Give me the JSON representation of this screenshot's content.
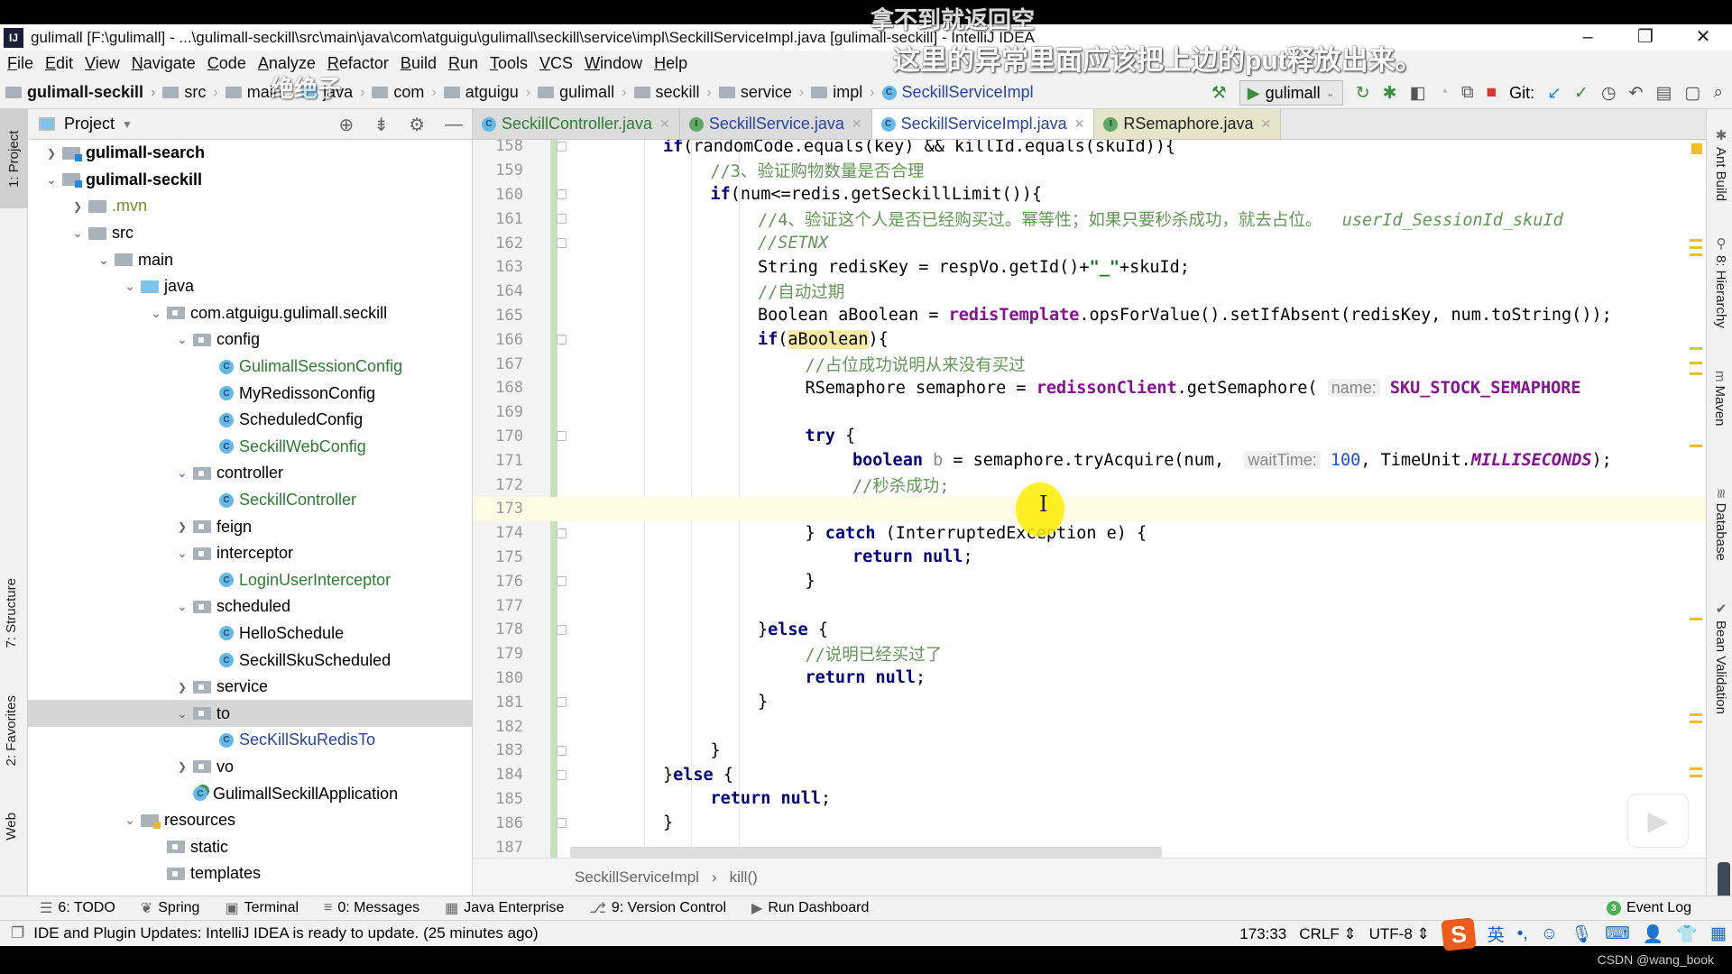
{
  "subtitles": {
    "line1": "拿不到就返回空",
    "line2": "这里的异常里面应该把上边的put释放出来。",
    "overlay": "绝绝子"
  },
  "window": {
    "logo": "IJ",
    "title": "gulimall [F:\\gulimall] - ...\\gulimall-seckill\\src\\main\\java\\com\\atguigu\\gulimall\\seckill\\service\\impl\\SeckillServiceImpl.java [gulimall-seckill] - IntelliJ IDEA",
    "controls": {
      "minimize": "–",
      "restore": "❐",
      "close": "✕"
    }
  },
  "menu": [
    "File",
    "Edit",
    "View",
    "Navigate",
    "Code",
    "Analyze",
    "Refactor",
    "Build",
    "Run",
    "Tools",
    "VCS",
    "Window",
    "Help"
  ],
  "navbar": {
    "crumbs": [
      "gulimall-seckill",
      "src",
      "main",
      "java",
      "com",
      "atguigu",
      "gulimall",
      "seckill",
      "service",
      "impl",
      "SeckillServiceImpl"
    ],
    "run_config": "gulimall",
    "git_label": "Git:"
  },
  "left_stripe": {
    "project": "1: Project",
    "structure": "7: Structure",
    "favorites": "2: Favorites",
    "web": "Web"
  },
  "right_stripe": [
    "Ant Build",
    "8: Hierarchy",
    "Maven",
    "Database",
    "Bean Validation"
  ],
  "project": {
    "title": "Project",
    "tree": [
      {
        "label": "gulimall-search",
        "depth": 0,
        "arrow": "›",
        "type": "mod",
        "style": "bold"
      },
      {
        "label": "gulimall-seckill",
        "depth": 0,
        "arrow": "⌄",
        "type": "mod",
        "style": "bold"
      },
      {
        "label": ".mvn",
        "depth": 1,
        "arrow": "›",
        "type": "folder",
        "style": "olive"
      },
      {
        "label": "src",
        "depth": 1,
        "arrow": "⌄",
        "type": "folder",
        "style": ""
      },
      {
        "label": "main",
        "depth": 2,
        "arrow": "⌄",
        "type": "folder",
        "style": ""
      },
      {
        "label": "java",
        "depth": 3,
        "arrow": "⌄",
        "type": "blue",
        "style": ""
      },
      {
        "label": "com.atguigu.gulimall.seckill",
        "depth": 4,
        "arrow": "⌄",
        "type": "pkg",
        "style": ""
      },
      {
        "label": "config",
        "depth": 5,
        "arrow": "⌄",
        "type": "pkg",
        "style": ""
      },
      {
        "label": "GulimallSessionConfig",
        "depth": 6,
        "arrow": "",
        "type": "class",
        "style": "green"
      },
      {
        "label": "MyRedissonConfig",
        "depth": 6,
        "arrow": "",
        "type": "class",
        "style": ""
      },
      {
        "label": "ScheduledConfig",
        "depth": 6,
        "arrow": "",
        "type": "class",
        "style": ""
      },
      {
        "label": "SeckillWebConfig",
        "depth": 6,
        "arrow": "",
        "type": "class",
        "style": "green"
      },
      {
        "label": "controller",
        "depth": 5,
        "arrow": "⌄",
        "type": "pkg",
        "style": ""
      },
      {
        "label": "SeckillController",
        "depth": 6,
        "arrow": "",
        "type": "class",
        "style": "green"
      },
      {
        "label": "feign",
        "depth": 5,
        "arrow": "›",
        "type": "pkg",
        "style": ""
      },
      {
        "label": "interceptor",
        "depth": 5,
        "arrow": "⌄",
        "type": "pkg",
        "style": ""
      },
      {
        "label": "LoginUserInterceptor",
        "depth": 6,
        "arrow": "",
        "type": "class",
        "style": "green"
      },
      {
        "label": "scheduled",
        "depth": 5,
        "arrow": "⌄",
        "type": "pkg",
        "style": ""
      },
      {
        "label": "HelloSchedule",
        "depth": 6,
        "arrow": "",
        "type": "class",
        "style": ""
      },
      {
        "label": "SeckillSkuScheduled",
        "depth": 6,
        "arrow": "",
        "type": "class",
        "style": ""
      },
      {
        "label": "service",
        "depth": 5,
        "arrow": "›",
        "type": "pkg",
        "style": ""
      },
      {
        "label": "to",
        "depth": 5,
        "arrow": "⌄",
        "type": "pkg",
        "style": "",
        "selected": true
      },
      {
        "label": "SecKillSkuRedisTo",
        "depth": 6,
        "arrow": "",
        "type": "class",
        "style": "blue"
      },
      {
        "label": "vo",
        "depth": 5,
        "arrow": "›",
        "type": "pkg",
        "style": ""
      },
      {
        "label": "GulimallSeckillApplication",
        "depth": 5,
        "arrow": "",
        "type": "app",
        "style": ""
      },
      {
        "label": "resources",
        "depth": 3,
        "arrow": "⌄",
        "type": "res",
        "style": ""
      },
      {
        "label": "static",
        "depth": 4,
        "arrow": "",
        "type": "pkg",
        "style": ""
      },
      {
        "label": "templates",
        "depth": 4,
        "arrow": "",
        "type": "pkg",
        "style": ""
      }
    ]
  },
  "editor": {
    "tabs": [
      {
        "label": "SeckillController.java",
        "icon": "C",
        "active": false
      },
      {
        "label": "SeckillService.java",
        "icon": "I",
        "active": false
      },
      {
        "label": "SeckillServiceImpl.java",
        "icon": "C",
        "active": true
      },
      {
        "label": "RSemaphore.java",
        "icon": "I",
        "active": false
      }
    ],
    "lines": [
      {
        "n": "158",
        "html": "<span class='kw'>if</span>(randomCode.equals(key) &amp;&amp; killId.equals(skuId)){",
        "indent": 2,
        "fold": true
      },
      {
        "n": "159",
        "html": "<span class='cm'>//3、验证购物数量是否合理</span>",
        "indent": 3
      },
      {
        "n": "160",
        "html": "<span class='kw'>if</span>(num&lt;=redis.getSeckillLimit()){",
        "indent": 3,
        "fold": true
      },
      {
        "n": "161",
        "html": "<span class='cm'>//4、验证这个人是否已经购买过。幂等性；如果只要秒杀成功，就去占位。  </span><span class='cmi'>userId_SessionId_skuId</span>",
        "indent": 4,
        "fold": true
      },
      {
        "n": "162",
        "html": "<span class='cmi'>//SETNX</span>",
        "indent": 4,
        "fold": true
      },
      {
        "n": "163",
        "html": "String redisKey = respVo.getId()+<span class='strlit'>\"_\"</span>+skuId;",
        "indent": 4
      },
      {
        "n": "164",
        "html": "<span class='cm'>//自动过期</span>",
        "indent": 4
      },
      {
        "n": "165",
        "html": "Boolean aBoolean = <span class='fld'>redisTemplate</span>.opsForValue().setIfAbsent(redisKey, num.toString());",
        "indent": 4
      },
      {
        "n": "166",
        "html": "<span class='kw'>if</span>(<span class='hl'>aBoolean</span>){",
        "indent": 4,
        "fold": true
      },
      {
        "n": "167",
        "html": "<span class='cm'>//占位成功说明从来没有买过</span>",
        "indent": 5
      },
      {
        "n": "168",
        "html": "RSemaphore semaphore = <span class='fld'>redissonClient</span>.getSemaphore( <span class='hint'>name:</span> <span class='const' style='font-style:normal'>SKU_STOCK_SEMAPHORE</span>",
        "indent": 5
      },
      {
        "n": "169",
        "html": "",
        "indent": 5
      },
      {
        "n": "170",
        "html": "<span class='kw'>try</span> {",
        "indent": 5,
        "fold": true
      },
      {
        "n": "171",
        "html": "<span class='kw'>boolean</span> <span style='color:#888'>b</span> = semaphore.tryAcquire(num,  <span class='hint'>waitTime:</span> <span class='num-lit'>100</span>, TimeUnit.<span class='const'>MILLISECONDS</span>);",
        "indent": 6
      },
      {
        "n": "172",
        "html": "<span class='cm'>//秒杀成功;</span>",
        "indent": 6
      },
      {
        "n": "173",
        "html": "",
        "indent": 6,
        "current": true
      },
      {
        "n": "174",
        "html": "} <span class='kw'>catch</span> (InterruptedException e) {",
        "indent": 5,
        "fold": true
      },
      {
        "n": "175",
        "html": "<span class='kw'>return null</span>;",
        "indent": 6
      },
      {
        "n": "176",
        "html": "}",
        "indent": 5,
        "fold": true
      },
      {
        "n": "177",
        "html": "",
        "indent": 5
      },
      {
        "n": "178",
        "html": "}<span class='kw'>else</span> {",
        "indent": 4,
        "fold": true
      },
      {
        "n": "179",
        "html": "<span class='cm'>//说明已经买过了</span>",
        "indent": 5
      },
      {
        "n": "180",
        "html": "<span class='kw'>return null</span>;",
        "indent": 5
      },
      {
        "n": "181",
        "html": "}",
        "indent": 4,
        "fold": true
      },
      {
        "n": "182",
        "html": "",
        "indent": 4
      },
      {
        "n": "183",
        "html": "}",
        "indent": 3,
        "fold": true
      },
      {
        "n": "184",
        "html": "}<span class='kw'>else</span> {",
        "indent": 2,
        "fold": true
      },
      {
        "n": "185",
        "html": "<span class='kw'>return null</span>;",
        "indent": 3
      },
      {
        "n": "186",
        "html": "}",
        "indent": 2,
        "fold": true
      },
      {
        "n": "187",
        "html": "",
        "indent": 2
      }
    ],
    "breadcrumb": {
      "class": "SeckillServiceImpl",
      "method": "kill()"
    }
  },
  "bottom_tools": [
    {
      "icon": "☰",
      "label": "6: TODO"
    },
    {
      "icon": "❦",
      "label": "Spring"
    },
    {
      "icon": "▣",
      "label": "Terminal"
    },
    {
      "icon": "≡",
      "label": "0: Messages"
    },
    {
      "icon": "▦",
      "label": "Java Enterprise"
    },
    {
      "icon": "⎇",
      "label": "9: Version Control"
    },
    {
      "icon": "▶",
      "label": "Run Dashboard"
    }
  ],
  "event_log": {
    "count": "3",
    "label": "Event Log"
  },
  "status": {
    "message": "IDE and Plugin Updates: IntelliJ IDEA is ready to update. (25 minutes ago)",
    "position": "173:33",
    "line_sep": "CRLF ⇕",
    "encoding": "UTF-8 ⇕",
    "ime_lang": "英"
  },
  "watermark": "CSDN @wang_book"
}
